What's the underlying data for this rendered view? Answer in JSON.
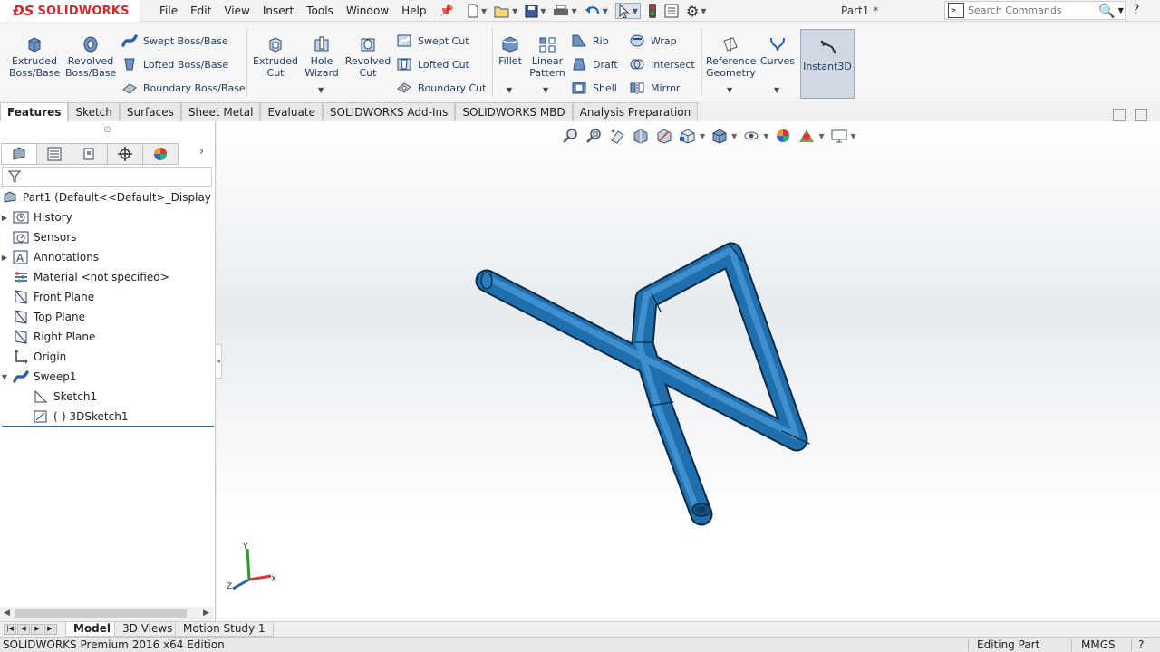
{
  "app": {
    "brand": "SOLIDWORKS",
    "document_title": "Part1 *"
  },
  "menus": [
    "File",
    "Edit",
    "View",
    "Insert",
    "Tools",
    "Window",
    "Help"
  ],
  "search": {
    "placeholder": "Search Commands"
  },
  "ribbon": {
    "extruded_boss": "Extruded\nBoss/Base",
    "revolved_boss": "Revolved\nBoss/Base",
    "swept_boss": "Swept Boss/Base",
    "lofted_boss": "Lofted Boss/Base",
    "boundary_boss": "Boundary Boss/Base",
    "extruded_cut": "Extruded\nCut",
    "hole_wizard": "Hole\nWizard",
    "revolved_cut": "Revolved\nCut",
    "swept_cut": "Swept Cut",
    "lofted_cut": "Lofted Cut",
    "boundary_cut": "Boundary Cut",
    "fillet": "Fillet",
    "linear_pattern": "Linear\nPattern",
    "rib": "Rib",
    "draft": "Draft",
    "shell": "Shell",
    "wrap": "Wrap",
    "intersect": "Intersect",
    "mirror": "Mirror",
    "reference_geometry": "Reference\nGeometry",
    "curves": "Curves",
    "instant3d": "Instant3D"
  },
  "command_tabs": [
    "Features",
    "Sketch",
    "Surfaces",
    "Sheet Metal",
    "Evaluate",
    "SOLIDWORKS Add-Ins",
    "SOLIDWORKS MBD",
    "Analysis Preparation"
  ],
  "tree": {
    "root": "Part1  (Default<<Default>_Display State",
    "items": [
      {
        "label": "History"
      },
      {
        "label": "Sensors"
      },
      {
        "label": "Annotations"
      },
      {
        "label": "Material <not specified>"
      },
      {
        "label": "Front Plane"
      },
      {
        "label": "Top Plane"
      },
      {
        "label": "Right Plane"
      },
      {
        "label": "Origin"
      },
      {
        "label": "Sweep1"
      },
      {
        "label": "Sketch1"
      },
      {
        "label": "(-) 3DSketch1"
      }
    ]
  },
  "triad": {
    "x": "X",
    "y": "Y",
    "z": "Z"
  },
  "bottom_tabs": [
    "Model",
    "3D Views",
    "Motion Study 1"
  ],
  "status": {
    "edition": "SOLIDWORKS Premium 2016 x64 Edition",
    "mode": "Editing Part",
    "units": "MMGS",
    "help": "?"
  },
  "colors": {
    "brand_red": "#d7262c",
    "model_blue": "#1f6fae",
    "active_tool_bg": "#d0d8e2"
  }
}
